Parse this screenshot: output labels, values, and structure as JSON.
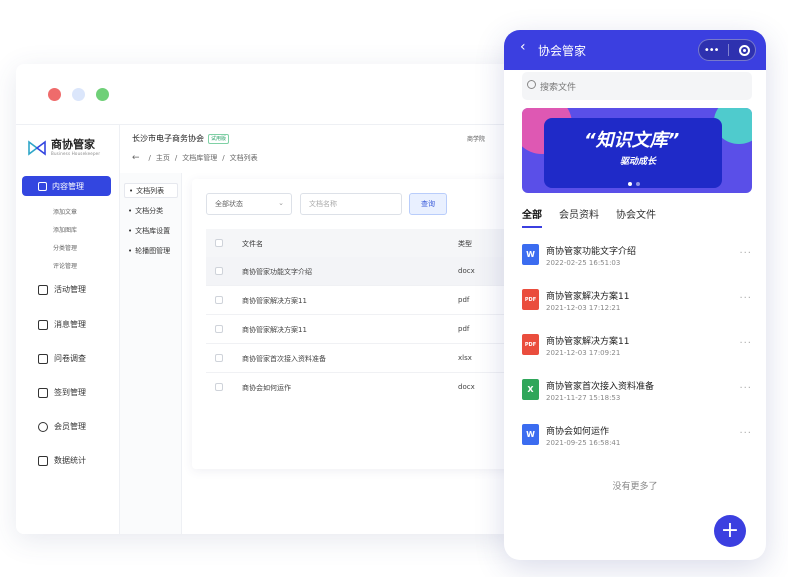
{
  "window_dots": {
    "red": "#ef6b6b",
    "blue": "#dbe6fb",
    "green": "#6fd078"
  },
  "colors": {
    "accent": "#3b3fe0",
    "word": "#3b6cf0",
    "pdf": "#ea4d3d",
    "excel": "#2fa65a"
  },
  "desktop": {
    "logo": {
      "name": "商协管家",
      "subtitle": "Business Housekeeper"
    },
    "org_name": "长沙市电子商务协会",
    "trial_badge": "试用版",
    "academy": "商学院",
    "breadcrumb": [
      "主页",
      "文档库管理",
      "文档列表"
    ],
    "sidebar": {
      "active": "内容管理",
      "sub_items": [
        "添加文章",
        "添加图库",
        "分类管理",
        "评论管理"
      ],
      "items": [
        "活动管理",
        "消息管理",
        "问卷调查",
        "签到管理",
        "会员管理",
        "数据统计"
      ]
    },
    "subnav": [
      "文档列表",
      "文档分类",
      "文档库设置",
      "轮播图管理"
    ],
    "filters": {
      "status": "全部状态",
      "name_placeholder": "文档名称",
      "query": "查询"
    },
    "table": {
      "headers": {
        "name": "文件名",
        "type": "类型"
      },
      "rows": [
        {
          "name": "商协管家功能文字介绍",
          "type": "docx"
        },
        {
          "name": "商协管家解决方案11",
          "type": "pdf"
        },
        {
          "name": "商协管家解决方案11",
          "type": "pdf"
        },
        {
          "name": "商协管家首次接入资料准备",
          "type": "xlsx"
        },
        {
          "name": "商协会如何运作",
          "type": "docx"
        }
      ]
    }
  },
  "phone": {
    "title": "协会管家",
    "search_placeholder": "搜索文件",
    "banner": {
      "title": "知识文库",
      "subtitle": "驱动成长"
    },
    "tabs": [
      "全部",
      "会员资料",
      "协会文件"
    ],
    "files": [
      {
        "name": "商协管家功能文字介绍",
        "date": "2022-02-25 16:51:03",
        "icon": "W",
        "kind": "word"
      },
      {
        "name": "商协管家解决方案11",
        "date": "2021-12-03 17:12:21",
        "icon": "PDF",
        "kind": "pdf"
      },
      {
        "name": "商协管家解决方案11",
        "date": "2021-12-03 17:09:21",
        "icon": "PDF",
        "kind": "pdf"
      },
      {
        "name": "商协管家首次接入资料准备",
        "date": "2021-11-27 15:18:53",
        "icon": "X",
        "kind": "excel"
      },
      {
        "name": "商协会如何运作",
        "date": "2021-09-25 16:58:41",
        "icon": "W",
        "kind": "word"
      }
    ],
    "no_more": "没有更多了",
    "fab": "+"
  }
}
